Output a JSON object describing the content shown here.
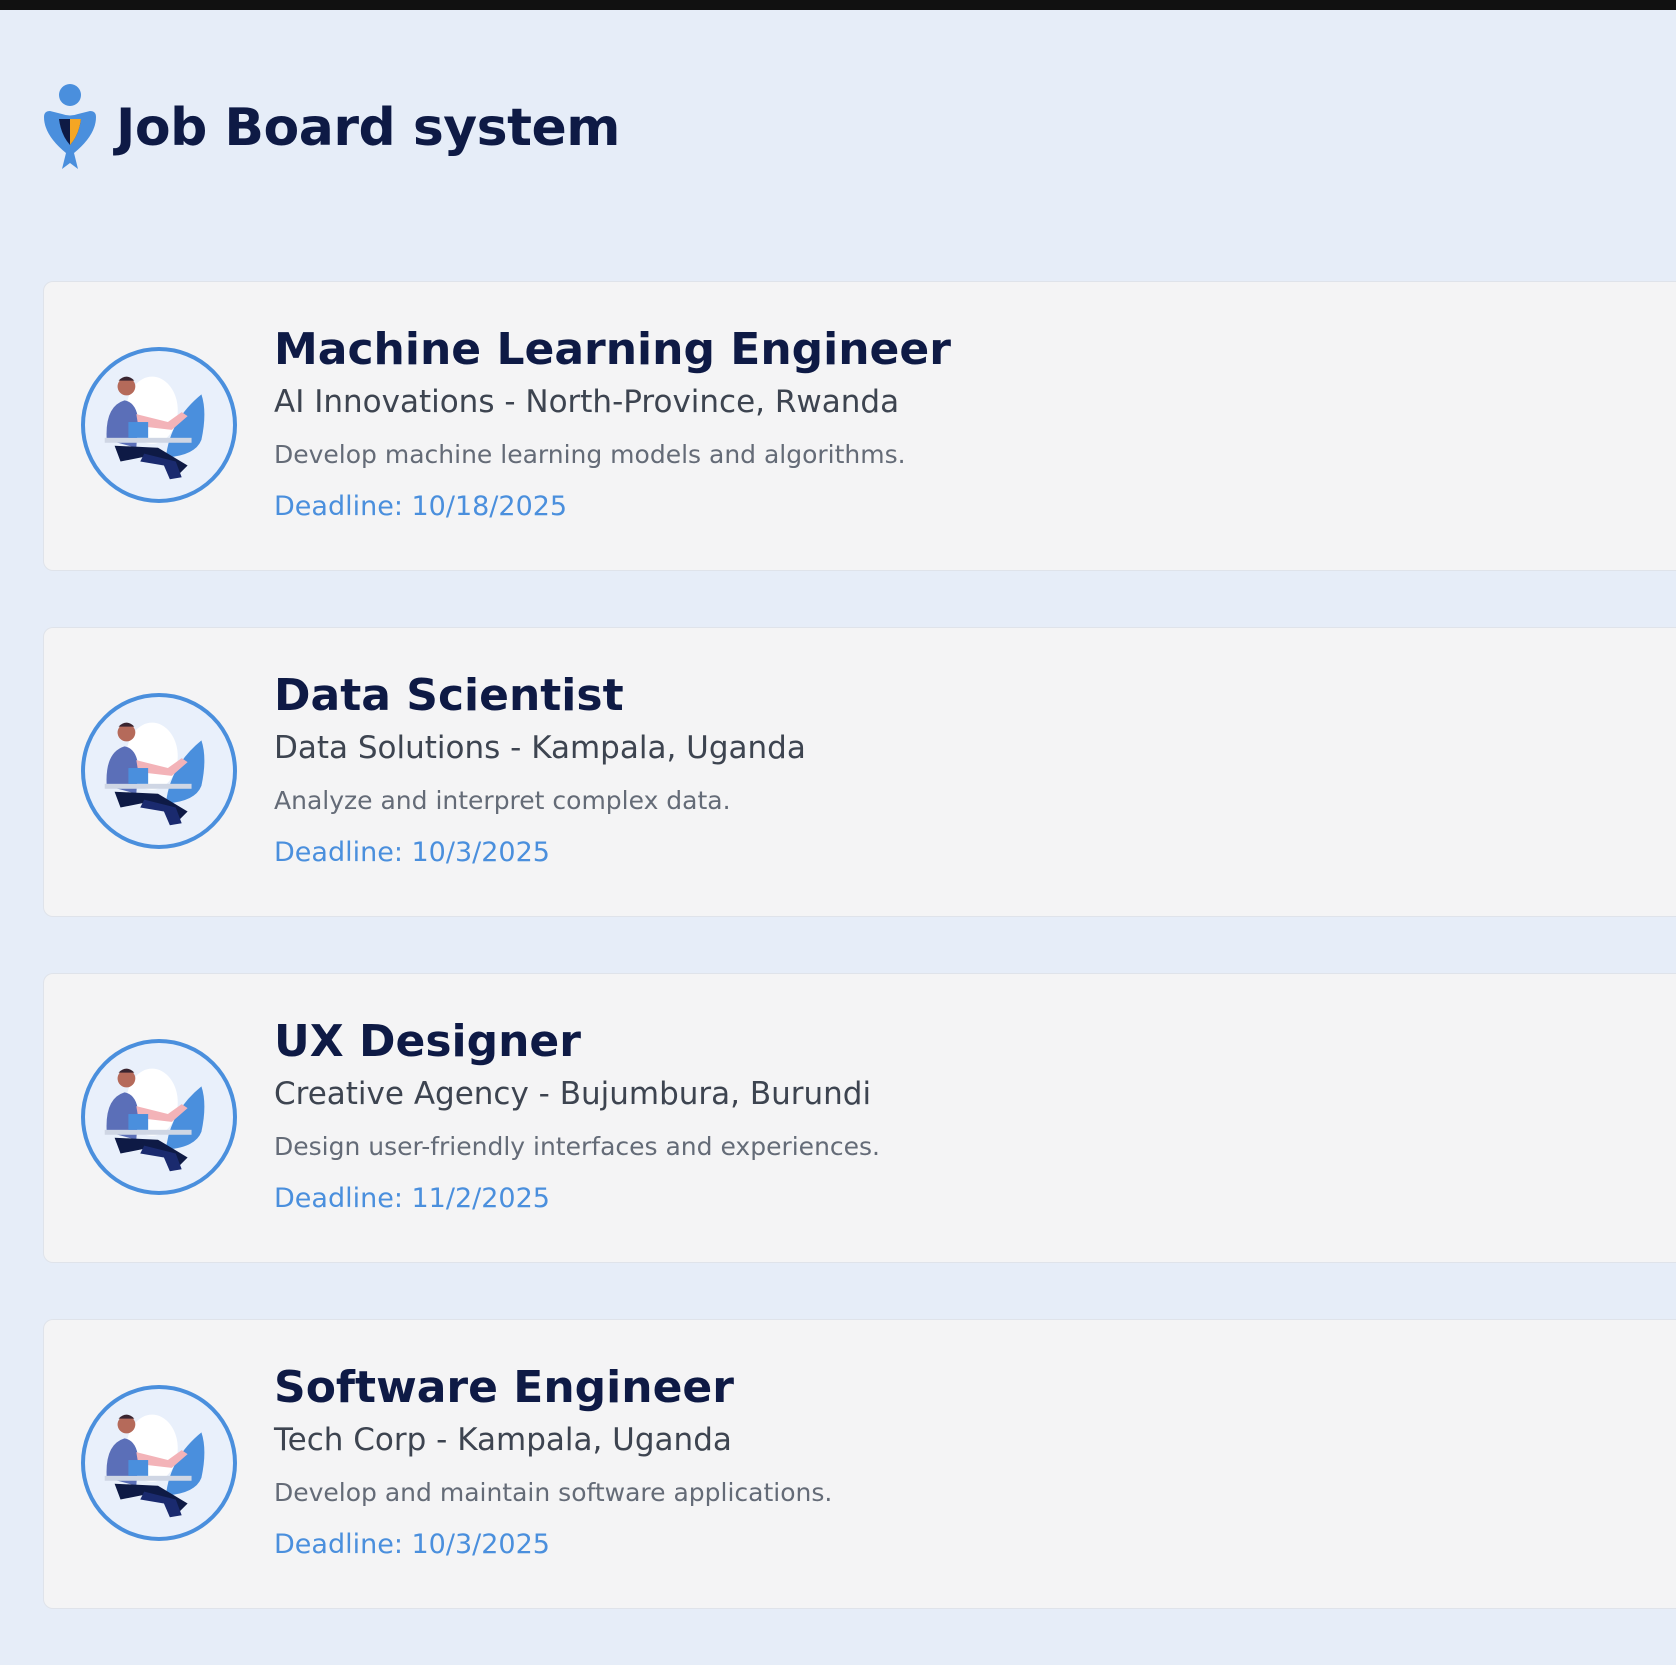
{
  "app": {
    "title": "Job Board system",
    "logo_icon": "job-board-logo-icon",
    "colors": {
      "background": "#e6edf8",
      "card": "#f4f4f5",
      "title": "#0e1a45",
      "accent": "#4a8fdd",
      "logo_orange": "#f5a623"
    }
  },
  "jobs": [
    {
      "title": "Machine Learning Engineer",
      "company_location": "AI Innovations - North-Province, Rwanda",
      "description": "Develop machine learning models and algorithms.",
      "deadline": "Deadline: 10/18/2025",
      "avatar_icon": "worker-at-desk-illustration"
    },
    {
      "title": "Data Scientist",
      "company_location": "Data Solutions - Kampala, Uganda",
      "description": "Analyze and interpret complex data.",
      "deadline": "Deadline: 10/3/2025",
      "avatar_icon": "worker-at-desk-illustration"
    },
    {
      "title": "UX Designer",
      "company_location": "Creative Agency - Bujumbura, Burundi",
      "description": "Design user-friendly interfaces and experiences.",
      "deadline": "Deadline: 11/2/2025",
      "avatar_icon": "worker-at-desk-illustration"
    },
    {
      "title": "Software Engineer",
      "company_location": "Tech Corp - Kampala, Uganda",
      "description": "Develop and maintain software applications.",
      "deadline": "Deadline: 10/3/2025",
      "avatar_icon": "worker-at-desk-illustration"
    }
  ]
}
